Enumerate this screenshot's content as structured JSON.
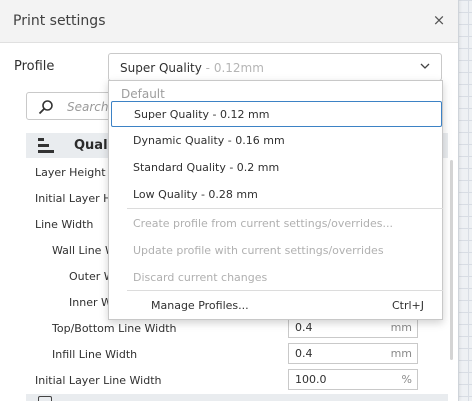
{
  "window": {
    "title": "Print settings",
    "close_glyph": "×"
  },
  "profile": {
    "label": "Profile",
    "selected_name": "Super Quality",
    "selected_suffix": " - 0.12mm"
  },
  "search": {
    "placeholder": "Search"
  },
  "section": {
    "label": "Quali"
  },
  "settings": [
    {
      "label": "Layer Height"
    },
    {
      "label": "Initial Layer H"
    },
    {
      "label": "Line Width"
    },
    {
      "label": "Wall Line W"
    },
    {
      "label": "Outer W"
    },
    {
      "label": "Inner W"
    },
    {
      "label": "Top/Bottom Line Width",
      "value": "0.4",
      "unit": "mm"
    },
    {
      "label": "Infill Line Width",
      "value": "0.4",
      "unit": "mm"
    },
    {
      "label": "Initial Layer Line Width",
      "value": "100.0",
      "unit": "%"
    }
  ],
  "dropdown": {
    "header": "Default",
    "profiles": [
      "Super Quality - 0.12 mm",
      "Dynamic Quality - 0.16 mm",
      "Standard Quality - 0.2 mm",
      "Low Quality - 0.28 mm"
    ],
    "actions": [
      "Create profile from current settings/overrides...",
      "Update profile with current settings/overrides",
      "Discard current changes"
    ],
    "manage_label": "Manage Profiles...",
    "manage_shortcut": "Ctrl+J"
  },
  "colors": {
    "accent_border": "#3d82c5",
    "disabled_text": "#b0b0b0"
  },
  "icons": {
    "close": "close-icon",
    "chevron": "chevron-down-icon",
    "search": "search-icon",
    "section": "quality-section-icon"
  }
}
